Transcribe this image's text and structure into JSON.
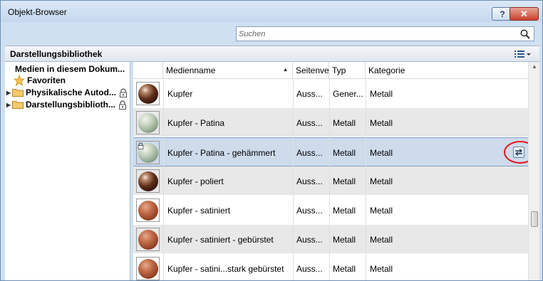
{
  "window": {
    "title": "Objekt-Browser",
    "help_label": "?",
    "close_label": "✕"
  },
  "search": {
    "placeholder": "Suchen",
    "value": ""
  },
  "library_header": {
    "title": "Darstellungsbibliothek"
  },
  "tree": {
    "items": [
      {
        "label": "Medien in diesem Dokum...",
        "icon": "none",
        "arrow": "",
        "locked": false
      },
      {
        "label": "Favoriten",
        "icon": "star-icon",
        "arrow": "",
        "locked": false
      },
      {
        "label": "Physikalische Autod...",
        "icon": "folder-icon",
        "arrow": "▶",
        "locked": true
      },
      {
        "label": "Darstellungsbiblioth...",
        "icon": "folder-icon",
        "arrow": "▶",
        "locked": true
      }
    ]
  },
  "table": {
    "columns": [
      "Medienname",
      "Seitenve",
      "Typ",
      "Kategorie"
    ],
    "sort_indicator": "▲",
    "rows": [
      {
        "name": "Kupfer",
        "seite": "Auss...",
        "typ": "Gener...",
        "kategorie": "Metall",
        "sphere": "shiny-dark",
        "locked": false,
        "selected": false
      },
      {
        "name": "Kupfer - Patina",
        "seite": "Auss...",
        "typ": "Metall",
        "kategorie": "Metall",
        "sphere": "patina",
        "locked": false,
        "selected": false
      },
      {
        "name": "Kupfer - Patina - gehämmert",
        "seite": "Auss...",
        "typ": "Metall",
        "kategorie": "Metall",
        "sphere": "patina",
        "locked": true,
        "selected": true
      },
      {
        "name": "Kupfer - poliert",
        "seite": "Auss...",
        "typ": "Metall",
        "kategorie": "Metall",
        "sphere": "shiny-dark",
        "locked": false,
        "selected": false
      },
      {
        "name": "Kupfer - satiniert",
        "seite": "Auss...",
        "typ": "Metall",
        "kategorie": "Metall",
        "sphere": "satin",
        "locked": false,
        "selected": false
      },
      {
        "name": "Kupfer - satiniert - gebürstet",
        "seite": "Auss...",
        "typ": "Metall",
        "kategorie": "Metall",
        "sphere": "satin",
        "locked": false,
        "selected": false
      },
      {
        "name": "Kupfer - satini...stark gebürstet",
        "seite": "Auss...",
        "typ": "Metall",
        "kategorie": "Metall",
        "sphere": "satin",
        "locked": false,
        "selected": false
      }
    ]
  },
  "colors": {
    "accent": "#cddbeb",
    "highlight_ring": "#e8141b",
    "window_bg": "#cfe0f1"
  }
}
